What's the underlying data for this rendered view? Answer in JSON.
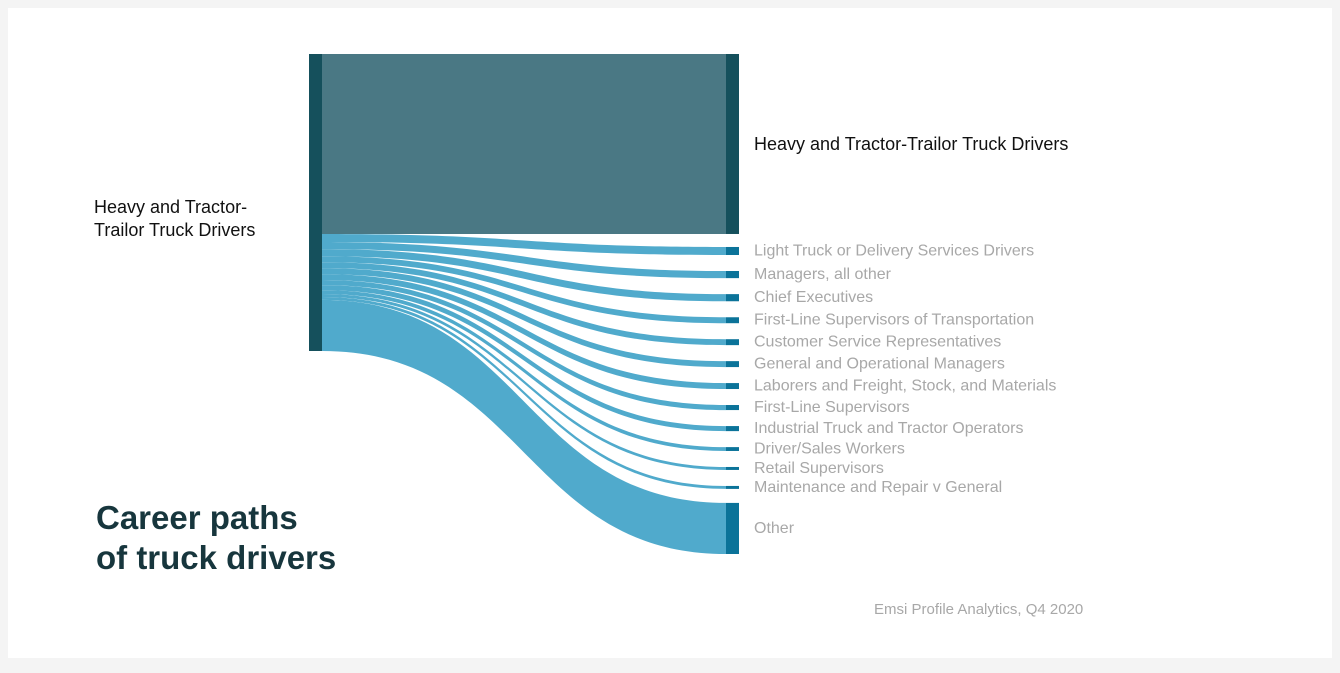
{
  "title": "Career paths of truck drivers",
  "title_lines": [
    "Career paths",
    "of truck drivers"
  ],
  "source": "Emsi Profile Analytics, Q4 2020",
  "colors": {
    "source_node": "#15505c",
    "self_link": "#4a7884",
    "self_node": "#15505c",
    "other_link": "#50aacc",
    "other_node": "#0b7399",
    "primary_label": "#111111",
    "secondary_label": "#a8a8a8"
  },
  "chart_data": {
    "type": "sankey",
    "title": "Career paths of truck drivers",
    "source_label": "Heavy and Tractor-Trailor Truck Drivers",
    "source_label_lines": [
      "Heavy and Tractor-",
      "Trailor Truck Drivers"
    ],
    "targets": [
      {
        "name": "Heavy and Tractor-Trailor Truck Drivers",
        "value": 60.6
      },
      {
        "name": "Light Truck or Delivery Services Drivers",
        "value": 2.7
      },
      {
        "name": "Managers, all other",
        "value": 2.4
      },
      {
        "name": "Chief Executives",
        "value": 2.4
      },
      {
        "name": "First-Line Supervisors of Transportation",
        "value": 2.0
      },
      {
        "name": "Customer Service Representatives",
        "value": 2.0
      },
      {
        "name": "General and Operational Managers",
        "value": 2.0
      },
      {
        "name": "Laborers and Freight, Stock, and Materials",
        "value": 2.0
      },
      {
        "name": "First-Line Supervisors",
        "value": 1.7
      },
      {
        "name": "Industrial Truck and Tractor Operators",
        "value": 1.7
      },
      {
        "name": "Driver/Sales Workers",
        "value": 1.3
      },
      {
        "name": "Retail Supervisors",
        "value": 1.0
      },
      {
        "name": "Maintenance and Repair v General",
        "value": 1.0
      },
      {
        "name": "Other",
        "value": 17.2
      }
    ]
  }
}
